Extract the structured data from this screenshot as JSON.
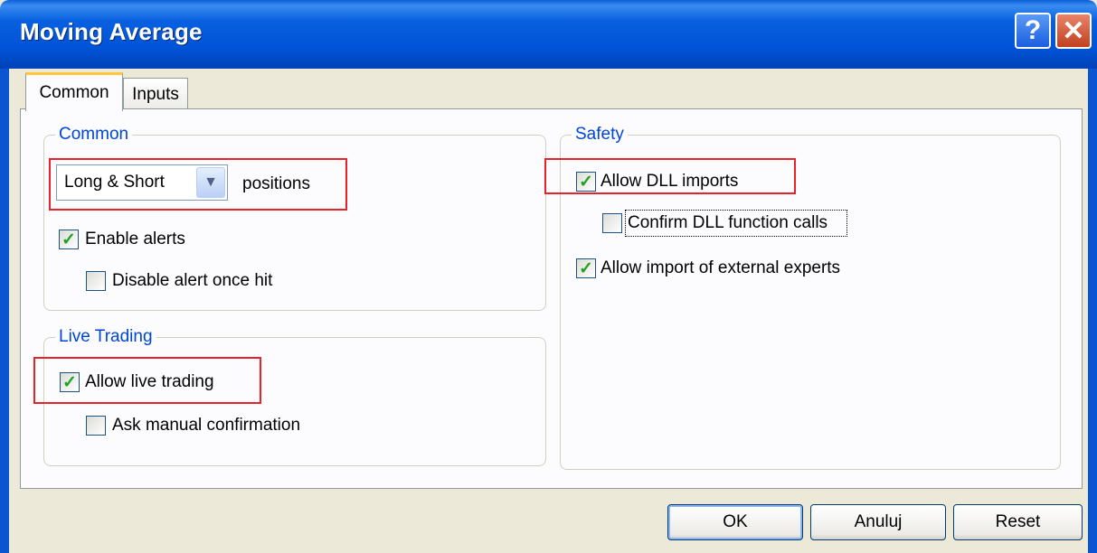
{
  "window": {
    "title": "Moving Average",
    "help_glyph": "?",
    "close_glyph": "✕"
  },
  "tabs": [
    {
      "label": "Common",
      "active": true
    },
    {
      "label": "Inputs",
      "active": false
    }
  ],
  "common_group": {
    "legend": "Common",
    "positions_select": {
      "value": "Long & Short",
      "suffix": "positions"
    },
    "enable_alerts": {
      "label": "Enable alerts",
      "checked": true
    },
    "disable_alert_once_hit": {
      "label": "Disable alert once hit",
      "checked": false
    }
  },
  "live_trading_group": {
    "legend": "Live Trading",
    "allow_live_trading": {
      "label": "Allow live trading",
      "checked": true
    },
    "ask_manual_confirmation": {
      "label": "Ask manual confirmation",
      "checked": false
    }
  },
  "safety_group": {
    "legend": "Safety",
    "allow_dll_imports": {
      "label": "Allow DLL imports",
      "checked": true
    },
    "confirm_dll_function_calls": {
      "label": "Confirm DLL function calls",
      "checked": false
    },
    "allow_import_external_experts": {
      "label": "Allow import of external experts",
      "checked": true
    }
  },
  "buttons": {
    "ok": "OK",
    "cancel": "Anuluj",
    "reset": "Reset"
  },
  "colors": {
    "title_bar": "#0054e3",
    "dialog_bg": "#ece9d8",
    "legend_text": "#0046d5",
    "highlight_box": "#e8222a",
    "check_mark": "#21a121"
  }
}
